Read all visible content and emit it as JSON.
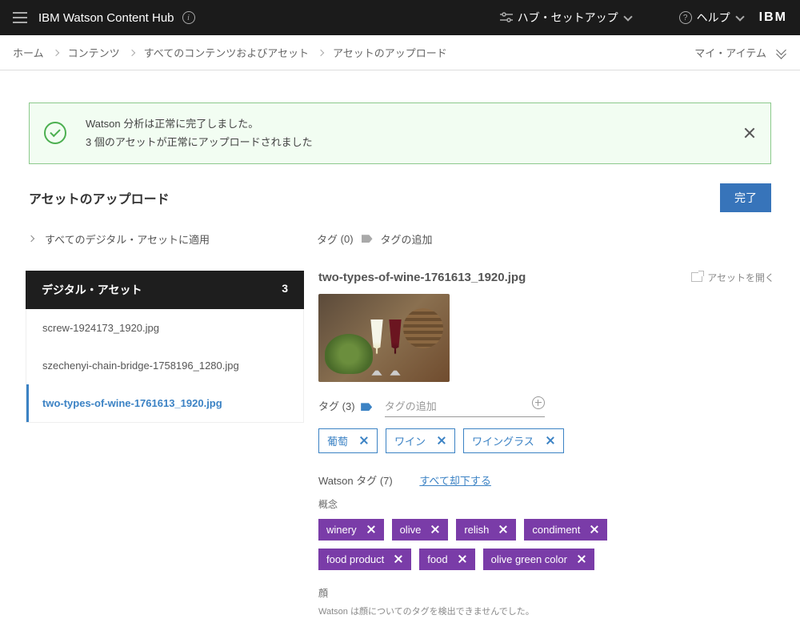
{
  "topbar": {
    "appName": "IBM Watson Content Hub",
    "hubSetup": "ハブ・セットアップ",
    "help": "ヘルプ",
    "ibm": "IBM"
  },
  "breadcrumbs": {
    "home": "ホーム",
    "content": "コンテンツ",
    "all": "すべてのコンテンツおよびアセット",
    "upload": "アセットのアップロード",
    "myItems": "マイ・アイテム"
  },
  "toast": {
    "line1": "Watson 分析は正常に完了しました。",
    "line2": "3 個のアセットが正常にアップロードされました"
  },
  "page": {
    "title": "アセットのアップロード",
    "done": "完了",
    "applyAll": "すべてのデジタル・アセットに適用",
    "tagsPrefix": "タグ",
    "tagsCount": "(0)",
    "addTag": "タグの追加"
  },
  "sidebar": {
    "title": "デジタル・アセット",
    "count": "3",
    "items": [
      {
        "name": "screw-1924173_1920.jpg"
      },
      {
        "name": "szechenyi-chain-bridge-1758196_1280.jpg"
      },
      {
        "name": "two-types-of-wine-1761613_1920.jpg"
      }
    ]
  },
  "detail": {
    "filename": "two-types-of-wine-1761613_1920.jpg",
    "openAsset": "アセットを開く",
    "tagsLabel": "タグ",
    "tagsCount": "(3)",
    "addTagPh": "タグの追加",
    "tags": [
      "葡萄",
      "ワイン",
      "ワイングラス"
    ],
    "watsonLabel": "Watson タグ",
    "watsonCount": "(7)",
    "rejectAll": "すべて却下する",
    "conceptLabel": "概念",
    "watsonTagsRow1": [
      "winery",
      "olive",
      "relish",
      "condiment"
    ],
    "watsonTagsRow2": [
      "food product",
      "food",
      "olive green color"
    ],
    "faceLabel": "顔",
    "faceMsg": "Watson は顔についてのタグを検出できませんでした。"
  }
}
